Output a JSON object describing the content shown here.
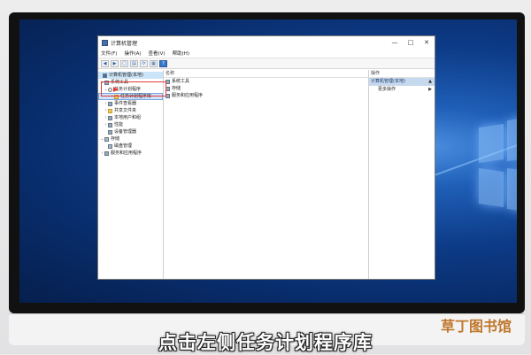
{
  "window": {
    "title": "计算机管理",
    "controls": [
      "—",
      "□",
      "✕"
    ]
  },
  "menubar": [
    "文件(F)",
    "操作(A)",
    "查看(V)",
    "帮助(H)"
  ],
  "toolbar_icons": [
    "back-icon",
    "forward-icon",
    "up-folder-icon",
    "show-hide-tree-icon",
    "refresh-icon",
    "properties-icon",
    "help-icon"
  ],
  "tree": {
    "root": "计算机管理(本地)",
    "system_tools": "系统工具",
    "task_scheduler": "任务计划程序",
    "task_scheduler_lib": "任务计划程序库",
    "event_viewer": "事件查看器",
    "shared_folders": "共享文件夹",
    "local_users": "本地用户和组",
    "performance": "性能",
    "device_manager": "设备管理器",
    "storage": "存储",
    "disk_management": "磁盘管理",
    "services_apps": "服务和应用程序"
  },
  "middle": {
    "header": "名称",
    "rows": [
      "系统工具",
      "存储",
      "服务和应用程序"
    ]
  },
  "actions": {
    "header": "操作",
    "title": "计算机管理(本地)",
    "more": "更多操作"
  },
  "caption": "点击左侧任务计划程序库",
  "watermark": "草丁图书馆"
}
